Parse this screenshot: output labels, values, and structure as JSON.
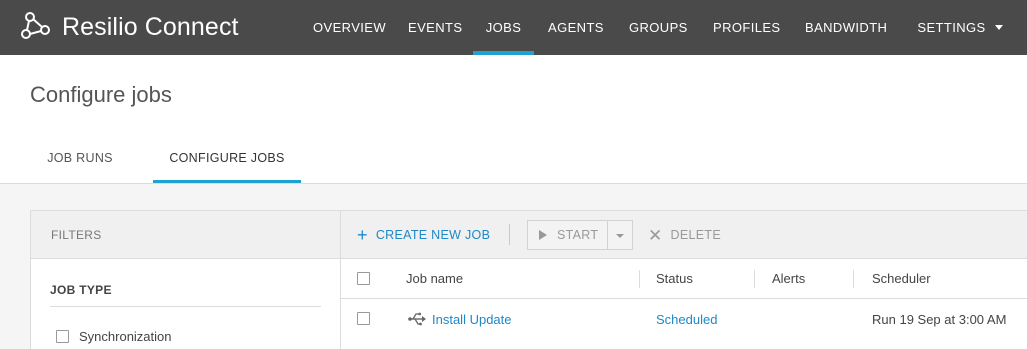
{
  "app": {
    "title": "Resilio Connect",
    "logo_icon": "resilio-logo-icon"
  },
  "nav": {
    "items": [
      {
        "label": "OVERVIEW",
        "active": false
      },
      {
        "label": "EVENTS",
        "active": false
      },
      {
        "label": "JOBS",
        "active": true
      },
      {
        "label": "AGENTS",
        "active": false
      },
      {
        "label": "GROUPS",
        "active": false
      },
      {
        "label": "PROFILES",
        "active": false
      },
      {
        "label": "BANDWIDTH",
        "active": false
      },
      {
        "label": "SETTINGS",
        "active": false
      }
    ]
  },
  "page": {
    "title": "Configure jobs"
  },
  "subtabs": [
    {
      "label": "JOB RUNS",
      "active": false
    },
    {
      "label": "CONFIGURE JOBS",
      "active": true
    }
  ],
  "filters": {
    "title": "FILTERS",
    "groups": [
      {
        "title": "JOB TYPE",
        "options": [
          {
            "label": "Synchronization",
            "checked": false
          }
        ]
      }
    ]
  },
  "toolbar": {
    "create_label": "CREATE NEW JOB",
    "start_label": "START",
    "delete_label": "DELETE"
  },
  "table": {
    "columns": [
      "Job name",
      "Status",
      "Alerts",
      "Scheduler"
    ],
    "rows": [
      {
        "checked": false,
        "icon": "usb-icon",
        "name": "Install Update",
        "status": "Scheduled",
        "alerts": "",
        "scheduler": "Run 19 Sep at 3:00 AM"
      }
    ]
  },
  "colors": {
    "topbar": "#4a4a4a",
    "accent": "#1ea2d4",
    "link": "#1e88c8",
    "content_bg": "#f5f5f5",
    "border": "#dcdcdc"
  }
}
